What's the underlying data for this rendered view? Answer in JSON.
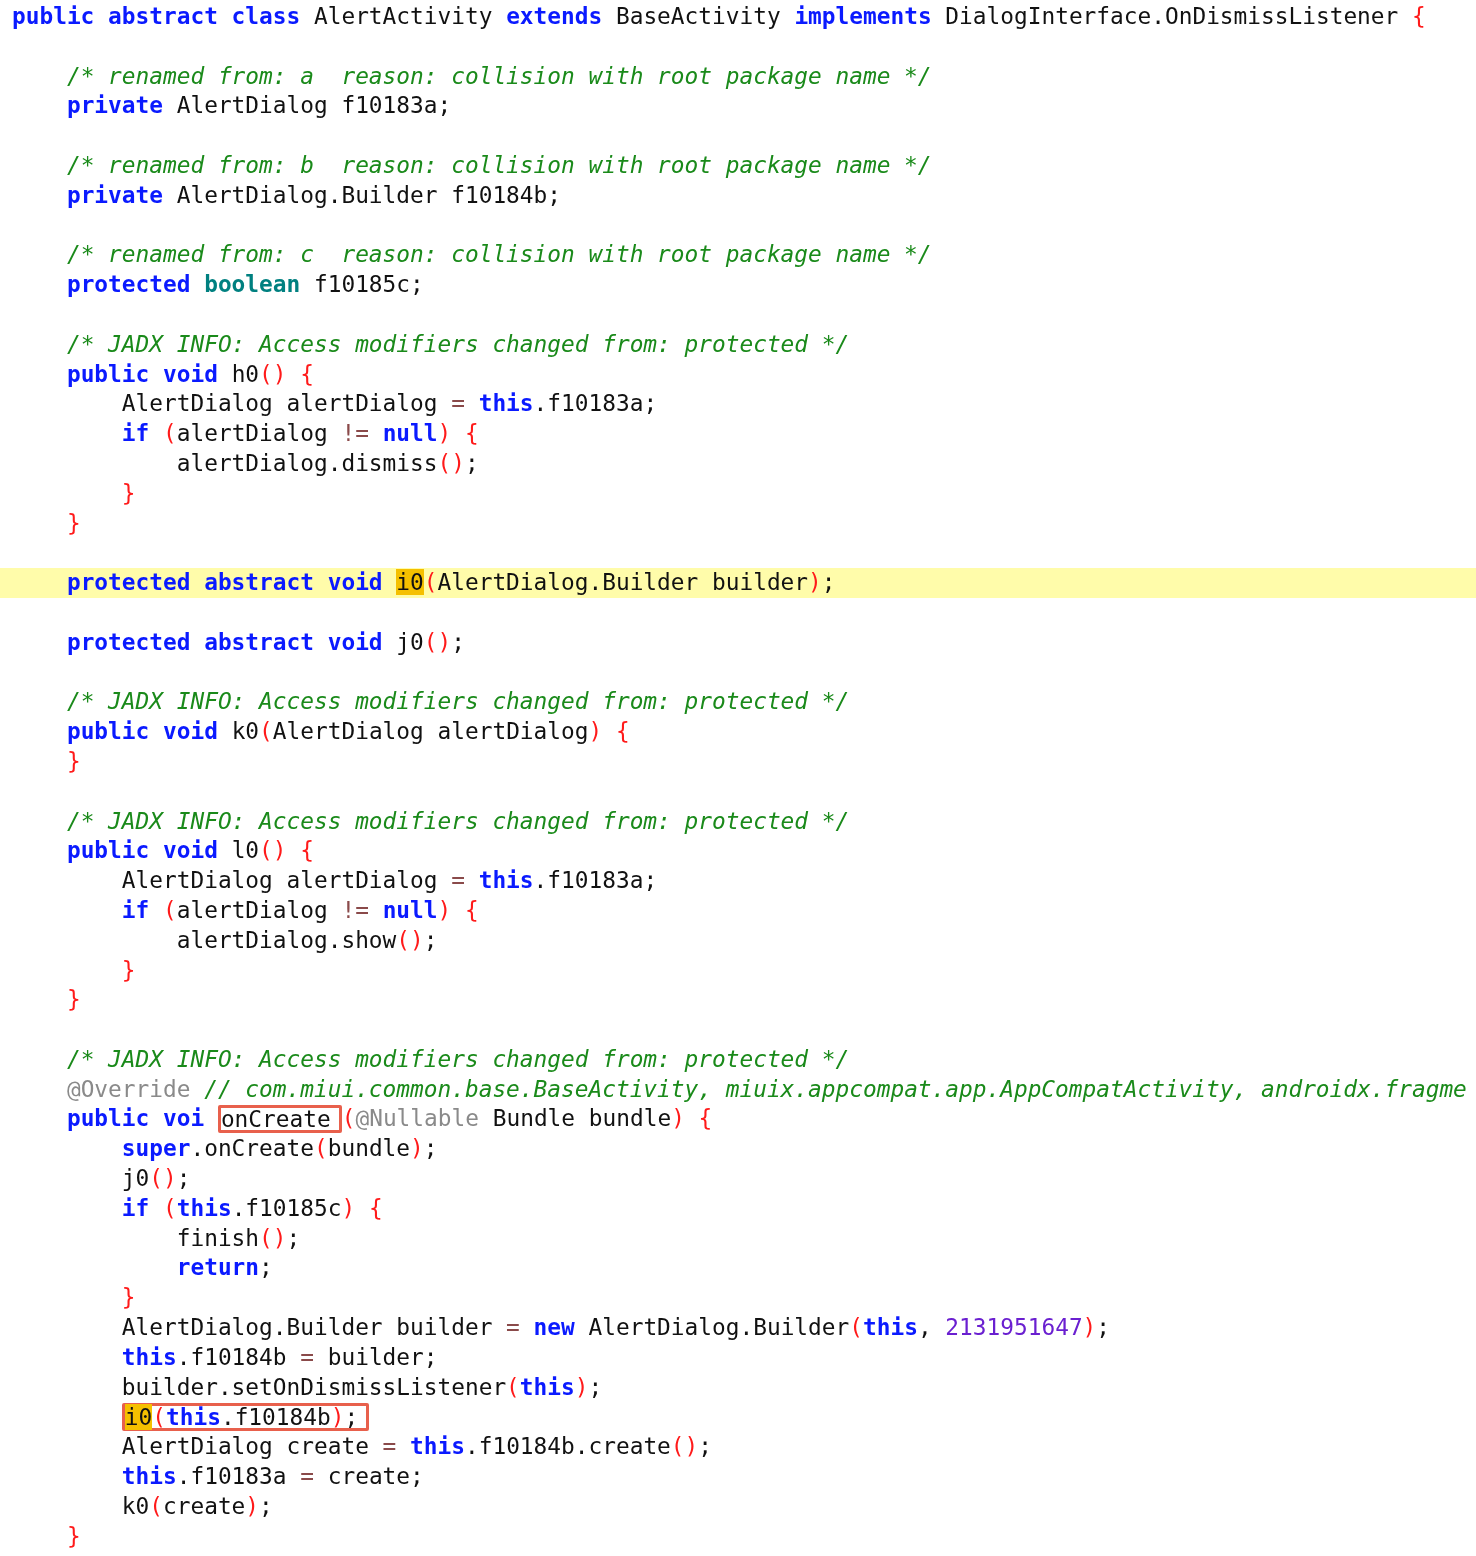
{
  "editor": {
    "lines": [
      {
        "selected": false,
        "tokens": [
          {
            "kind": "keyword",
            "text": "public abstract class"
          },
          {
            "kind": "text",
            "text": " AlertActivity "
          },
          {
            "kind": "keyword",
            "text": "extends"
          },
          {
            "kind": "text",
            "text": " BaseActivity "
          },
          {
            "kind": "keyword",
            "text": "implements"
          },
          {
            "kind": "text",
            "text": " DialogInterface.OnDismissListener "
          },
          {
            "kind": "brace",
            "text": "{"
          }
        ]
      },
      {
        "selected": false
      },
      {
        "selected": false,
        "tokens": [
          {
            "kind": "comment",
            "text": "    /* renamed from: a  reason: collision with root package name */"
          }
        ]
      },
      {
        "selected": false,
        "tokens": [
          {
            "kind": "keyword",
            "text": "    private"
          },
          {
            "kind": "text",
            "text": " AlertDialog f10183a;"
          }
        ]
      },
      {
        "selected": false
      },
      {
        "selected": false,
        "tokens": [
          {
            "kind": "comment",
            "text": "    /* renamed from: b  reason: collision with root package name */"
          }
        ]
      },
      {
        "selected": false,
        "tokens": [
          {
            "kind": "keyword",
            "text": "    private"
          },
          {
            "kind": "text",
            "text": " AlertDialog.Builder f10184b;"
          }
        ]
      },
      {
        "selected": false
      },
      {
        "selected": false,
        "tokens": [
          {
            "kind": "comment",
            "text": "    /* renamed from: c  reason: collision with root package name */"
          }
        ]
      },
      {
        "selected": false,
        "tokens": [
          {
            "kind": "keyword",
            "text": "    protected "
          },
          {
            "kind": "type",
            "text": "boolean"
          },
          {
            "kind": "text",
            "text": " f10185c;"
          }
        ]
      },
      {
        "selected": false
      },
      {
        "selected": false,
        "tokens": [
          {
            "kind": "comment",
            "text": "    /* JADX INFO: Access modifiers changed from: protected */"
          }
        ]
      },
      {
        "selected": false,
        "tokens": [
          {
            "kind": "keyword",
            "text": "    public void"
          },
          {
            "kind": "text",
            "text": " h0"
          },
          {
            "kind": "brace",
            "text": "() {"
          }
        ]
      },
      {
        "selected": false,
        "tokens": [
          {
            "kind": "text",
            "text": "        AlertDialog alertDialog "
          },
          {
            "kind": "operator",
            "text": "= "
          },
          {
            "kind": "keyword",
            "text": "this"
          },
          {
            "kind": "text",
            "text": ".f10183a;"
          }
        ]
      },
      {
        "selected": false,
        "tokens": [
          {
            "kind": "keyword",
            "text": "        if "
          },
          {
            "kind": "brace",
            "text": "("
          },
          {
            "kind": "text",
            "text": "alertDialog "
          },
          {
            "kind": "operator",
            "text": "!= "
          },
          {
            "kind": "keyword",
            "text": "null"
          },
          {
            "kind": "brace",
            "text": ") {"
          }
        ]
      },
      {
        "selected": false,
        "tokens": [
          {
            "kind": "text",
            "text": "            alertDialog.dismiss"
          },
          {
            "kind": "brace",
            "text": "()"
          },
          {
            "kind": "text",
            "text": ";"
          }
        ]
      },
      {
        "selected": false,
        "tokens": [
          {
            "kind": "brace",
            "text": "        }"
          }
        ]
      },
      {
        "selected": false,
        "tokens": [
          {
            "kind": "brace",
            "text": "    }"
          }
        ]
      },
      {
        "selected": false
      },
      {
        "selected": true,
        "tokens": [
          {
            "kind": "keyword",
            "text": "    protected abstract void "
          },
          {
            "kind": "match",
            "text": "i0"
          },
          {
            "kind": "brace",
            "text": "("
          },
          {
            "kind": "text",
            "text": "AlertDialog.Builder builder"
          },
          {
            "kind": "brace",
            "text": ")"
          },
          {
            "kind": "text",
            "text": ";"
          }
        ]
      },
      {
        "selected": false
      },
      {
        "selected": false,
        "tokens": [
          {
            "kind": "keyword",
            "text": "    protected abstract void"
          },
          {
            "kind": "text",
            "text": " j0"
          },
          {
            "kind": "brace",
            "text": "()"
          },
          {
            "kind": "text",
            "text": ";"
          }
        ]
      },
      {
        "selected": false
      },
      {
        "selected": false,
        "tokens": [
          {
            "kind": "comment",
            "text": "    /* JADX INFO: Access modifiers changed from: protected */"
          }
        ]
      },
      {
        "selected": false,
        "tokens": [
          {
            "kind": "keyword",
            "text": "    public void"
          },
          {
            "kind": "text",
            "text": " k0"
          },
          {
            "kind": "brace",
            "text": "("
          },
          {
            "kind": "text",
            "text": "AlertDialog alertDialog"
          },
          {
            "kind": "brace",
            "text": ") {"
          }
        ]
      },
      {
        "selected": false,
        "tokens": [
          {
            "kind": "brace",
            "text": "    }"
          }
        ]
      },
      {
        "selected": false
      },
      {
        "selected": false,
        "tokens": [
          {
            "kind": "comment",
            "text": "    /* JADX INFO: Access modifiers changed from: protected */"
          }
        ]
      },
      {
        "selected": false,
        "tokens": [
          {
            "kind": "keyword",
            "text": "    public void"
          },
          {
            "kind": "text",
            "text": " l0"
          },
          {
            "kind": "brace",
            "text": "() {"
          }
        ]
      },
      {
        "selected": false,
        "tokens": [
          {
            "kind": "text",
            "text": "        AlertDialog alertDialog "
          },
          {
            "kind": "operator",
            "text": "= "
          },
          {
            "kind": "keyword",
            "text": "this"
          },
          {
            "kind": "text",
            "text": ".f10183a;"
          }
        ]
      },
      {
        "selected": false,
        "tokens": [
          {
            "kind": "keyword",
            "text": "        if "
          },
          {
            "kind": "brace",
            "text": "("
          },
          {
            "kind": "text",
            "text": "alertDialog "
          },
          {
            "kind": "operator",
            "text": "!= "
          },
          {
            "kind": "keyword",
            "text": "null"
          },
          {
            "kind": "brace",
            "text": ") {"
          }
        ]
      },
      {
        "selected": false,
        "tokens": [
          {
            "kind": "text",
            "text": "            alertDialog.show"
          },
          {
            "kind": "brace",
            "text": "()"
          },
          {
            "kind": "text",
            "text": ";"
          }
        ]
      },
      {
        "selected": false,
        "tokens": [
          {
            "kind": "brace",
            "text": "        }"
          }
        ]
      },
      {
        "selected": false,
        "tokens": [
          {
            "kind": "brace",
            "text": "    }"
          }
        ]
      },
      {
        "selected": false
      },
      {
        "selected": false,
        "tokens": [
          {
            "kind": "comment",
            "text": "    /* JADX INFO: Access modifiers changed from: protected */"
          }
        ]
      },
      {
        "selected": false,
        "tokens": [
          {
            "kind": "annotation",
            "text": "    @Override "
          },
          {
            "kind": "comment",
            "text": "// com.miui.common.base.BaseActivity, miuix.appcompat.app.AppCompatActivity, androidx.fragme"
          }
        ]
      },
      {
        "selected": false,
        "tokens": [
          {
            "kind": "keyword",
            "text": "    public voi"
          },
          {
            "kind": "frame",
            "parts": [
              {
                "kind": "text",
                "text": " onCreate"
              }
            ]
          },
          {
            "kind": "brace",
            "text": "("
          },
          {
            "kind": "annotation",
            "text": "@Nullable"
          },
          {
            "kind": "text",
            "text": " Bundle bundle"
          },
          {
            "kind": "brace",
            "text": ") {"
          }
        ]
      },
      {
        "selected": false,
        "tokens": [
          {
            "kind": "keyword",
            "text": "        super"
          },
          {
            "kind": "text",
            "text": ".onCreate"
          },
          {
            "kind": "brace",
            "text": "("
          },
          {
            "kind": "text",
            "text": "bundle"
          },
          {
            "kind": "brace",
            "text": ")"
          },
          {
            "kind": "text",
            "text": ";"
          }
        ]
      },
      {
        "selected": false,
        "tokens": [
          {
            "kind": "text",
            "text": "        j0"
          },
          {
            "kind": "brace",
            "text": "()"
          },
          {
            "kind": "text",
            "text": ";"
          }
        ]
      },
      {
        "selected": false,
        "tokens": [
          {
            "kind": "keyword",
            "text": "        if "
          },
          {
            "kind": "brace",
            "text": "("
          },
          {
            "kind": "keyword",
            "text": "this"
          },
          {
            "kind": "text",
            "text": ".f10185c"
          },
          {
            "kind": "brace",
            "text": ") {"
          }
        ]
      },
      {
        "selected": false,
        "tokens": [
          {
            "kind": "text",
            "text": "            finish"
          },
          {
            "kind": "brace",
            "text": "()"
          },
          {
            "kind": "text",
            "text": ";"
          }
        ]
      },
      {
        "selected": false,
        "tokens": [
          {
            "kind": "keyword",
            "text": "            return"
          },
          {
            "kind": "text",
            "text": ";"
          }
        ]
      },
      {
        "selected": false,
        "tokens": [
          {
            "kind": "brace",
            "text": "        }"
          }
        ]
      },
      {
        "selected": false,
        "tokens": [
          {
            "kind": "text",
            "text": "        AlertDialog.Builder builder "
          },
          {
            "kind": "operator",
            "text": "= "
          },
          {
            "kind": "keyword",
            "text": "new"
          },
          {
            "kind": "text",
            "text": " AlertDialog.Builder"
          },
          {
            "kind": "brace",
            "text": "("
          },
          {
            "kind": "keyword",
            "text": "this"
          },
          {
            "kind": "text",
            "text": ", "
          },
          {
            "kind": "number",
            "text": "2131951647"
          },
          {
            "kind": "brace",
            "text": ")"
          },
          {
            "kind": "text",
            "text": ";"
          }
        ]
      },
      {
        "selected": false,
        "tokens": [
          {
            "kind": "keyword",
            "text": "        this"
          },
          {
            "kind": "text",
            "text": ".f10184b "
          },
          {
            "kind": "operator",
            "text": "="
          },
          {
            "kind": "text",
            "text": " builder;"
          }
        ]
      },
      {
        "selected": false,
        "tokens": [
          {
            "kind": "text",
            "text": "        builder.setOnDismissListener"
          },
          {
            "kind": "brace",
            "text": "("
          },
          {
            "kind": "keyword",
            "text": "this"
          },
          {
            "kind": "brace",
            "text": ")"
          },
          {
            "kind": "text",
            "text": ";"
          }
        ]
      },
      {
        "selected": false,
        "tokens": [
          {
            "kind": "frame",
            "parts": [
              {
                "kind": "match",
                "text": "        i0"
              },
              {
                "kind": "brace",
                "text": "("
              },
              {
                "kind": "keyword",
                "text": "this"
              },
              {
                "kind": "text",
                "text": ".f10184b"
              },
              {
                "kind": "brace",
                "text": ")"
              },
              {
                "kind": "text",
                "text": ";"
              }
            ]
          }
        ]
      },
      {
        "selected": false,
        "tokens": [
          {
            "kind": "text",
            "text": "        AlertDialog create "
          },
          {
            "kind": "operator",
            "text": "= "
          },
          {
            "kind": "keyword",
            "text": "this"
          },
          {
            "kind": "text",
            "text": ".f10184b.create"
          },
          {
            "kind": "brace",
            "text": "()"
          },
          {
            "kind": "text",
            "text": ";"
          }
        ]
      },
      {
        "selected": false,
        "tokens": [
          {
            "kind": "keyword",
            "text": "        this"
          },
          {
            "kind": "text",
            "text": ".f10183a "
          },
          {
            "kind": "operator",
            "text": "="
          },
          {
            "kind": "text",
            "text": " create;"
          }
        ]
      },
      {
        "selected": false,
        "tokens": [
          {
            "kind": "text",
            "text": "        k0"
          },
          {
            "kind": "brace",
            "text": "("
          },
          {
            "kind": "text",
            "text": "create"
          },
          {
            "kind": "brace",
            "text": ")"
          },
          {
            "kind": "text",
            "text": ";"
          }
        ]
      },
      {
        "selected": false,
        "tokens": [
          {
            "kind": "brace",
            "text": "    }"
          }
        ]
      }
    ]
  }
}
